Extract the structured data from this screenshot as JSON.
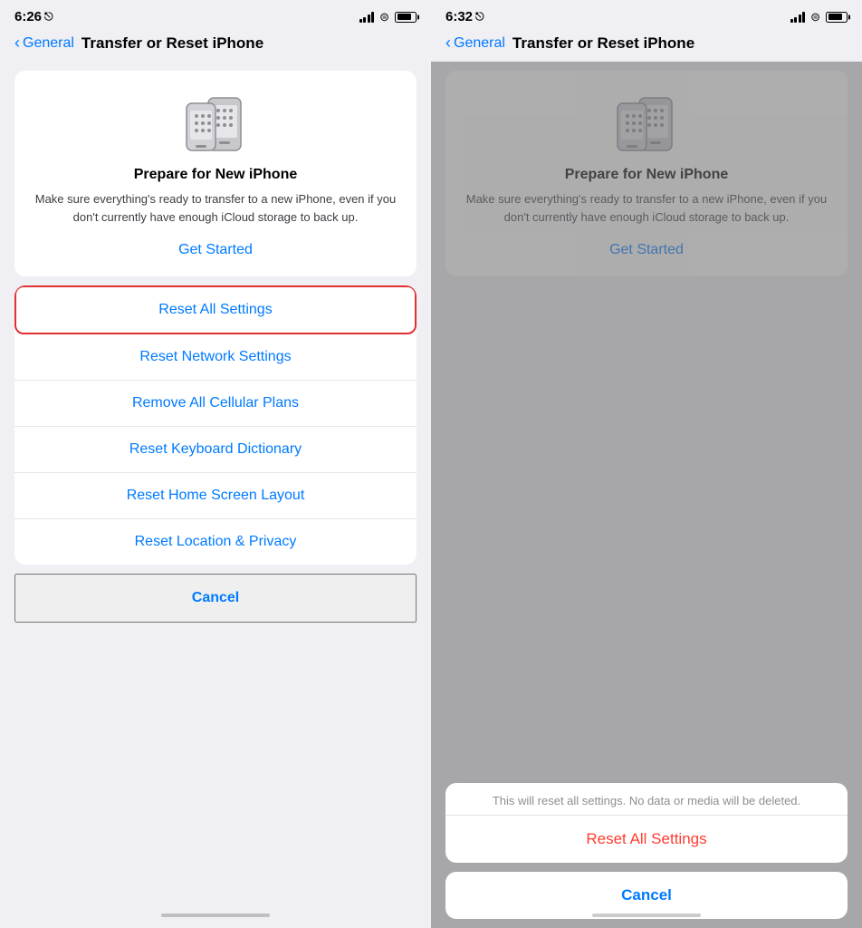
{
  "left_panel": {
    "status": {
      "time": "6:26",
      "location_icon": "▲"
    },
    "nav": {
      "back_label": "General",
      "title": "Transfer or Reset iPhone"
    },
    "prepare_card": {
      "title": "Prepare for New iPhone",
      "description": "Make sure everything's ready to transfer to a new iPhone, even if you don't currently have enough iCloud storage to back up.",
      "cta": "Get Started"
    },
    "options": [
      {
        "label": "Reset All Settings",
        "highlighted": true
      },
      {
        "label": "Reset Network Settings",
        "highlighted": false
      },
      {
        "label": "Remove All Cellular Plans",
        "highlighted": false
      },
      {
        "label": "Reset Keyboard Dictionary",
        "highlighted": false
      },
      {
        "label": "Reset Home Screen Layout",
        "highlighted": false
      },
      {
        "label": "Reset Location & Privacy",
        "highlighted": false
      }
    ],
    "cancel_label": "Cancel"
  },
  "right_panel": {
    "status": {
      "time": "6:32",
      "location_icon": "▲"
    },
    "nav": {
      "back_label": "General",
      "title": "Transfer or Reset iPhone"
    },
    "prepare_card": {
      "title": "Prepare for New iPhone",
      "description": "Make sure everything's ready to transfer to a new iPhone, even if you don't currently have enough iCloud storage to back up.",
      "cta": "Get Started"
    },
    "action_sheet": {
      "message": "This will reset all settings. No data or media will be deleted.",
      "destructive_label": "Reset All Settings",
      "cancel_label": "Cancel"
    }
  },
  "colors": {
    "blue": "#007aff",
    "red_border": "#e03030",
    "destructive": "#ff3b30",
    "text_secondary": "#8e8e93"
  }
}
